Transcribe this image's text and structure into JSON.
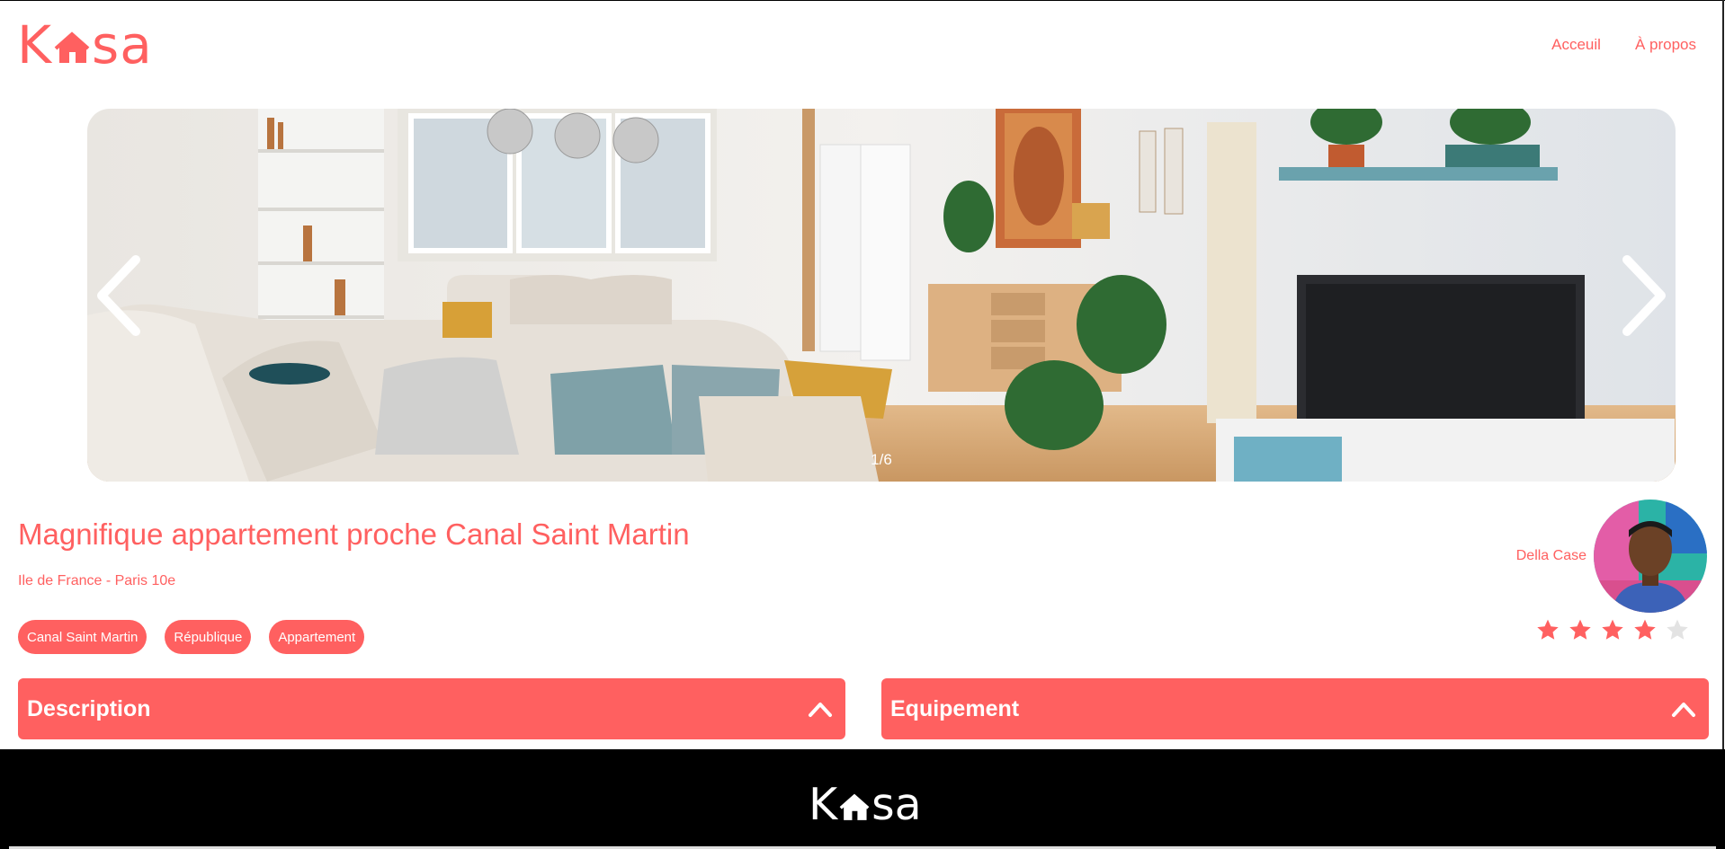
{
  "header": {
    "logo_left": "K",
    "logo_right": "sa",
    "nav": [
      {
        "label": "Acceuil"
      },
      {
        "label": "À propos"
      }
    ]
  },
  "carousel": {
    "counter": "1/6",
    "current": 1,
    "total": 6
  },
  "listing": {
    "title": "Magnifique appartement proche Canal Saint Martin",
    "location": "Ile de France - Paris 10e",
    "tags": [
      "Canal Saint Martin",
      "République",
      "Appartement"
    ],
    "host_name": "Della Case",
    "rating": 4,
    "rating_max": 5
  },
  "collapses": {
    "description": "Description",
    "equipment": "Equipement"
  },
  "footer": {
    "logo_left": "K",
    "logo_right": "sa"
  },
  "colors": {
    "accent": "#FF6060",
    "star_empty": "#E3E3E3",
    "footer_bg": "#000000"
  }
}
